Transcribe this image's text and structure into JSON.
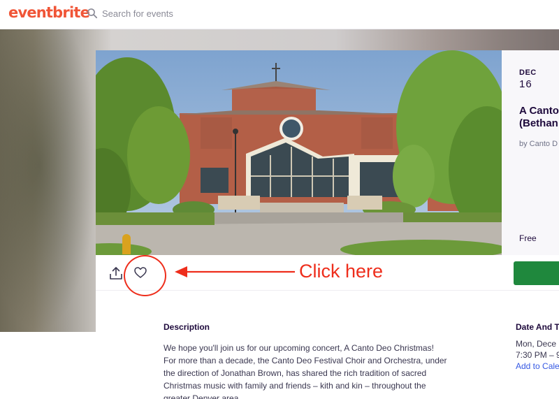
{
  "header": {
    "logo_text": "eventbrite",
    "search_placeholder": "Search for events"
  },
  "event": {
    "date_month": "DEC",
    "date_day": "16",
    "title": "A Canto\n(Bethan",
    "organizer": "by Canto D",
    "price": "Free"
  },
  "annotation": {
    "label": "Click here"
  },
  "description": {
    "heading": "Description",
    "lines": [
      "We hope you'll join us for our upcoming concert, A Canto Deo Christmas!",
      "For more than a decade, the Canto Deo Festival Choir and Orchestra, under",
      "the direction of Jonathan Brown, has shared the rich tradition of sacred",
      "Christmas music with family and friends – kith and kin – throughout the",
      "greater Denver area."
    ]
  },
  "date_time": {
    "heading": "Date And T",
    "date": "Mon, Dece",
    "time": "7:30 PM – 9",
    "add_to_calendar": "Add to Cale"
  },
  "colors": {
    "brand": "#f05537",
    "annotation": "#ee2e1c",
    "cta": "#1f883d",
    "link": "#3659e3"
  },
  "icons": {
    "search": "search-icon",
    "share": "share-icon",
    "like": "heart-icon"
  }
}
